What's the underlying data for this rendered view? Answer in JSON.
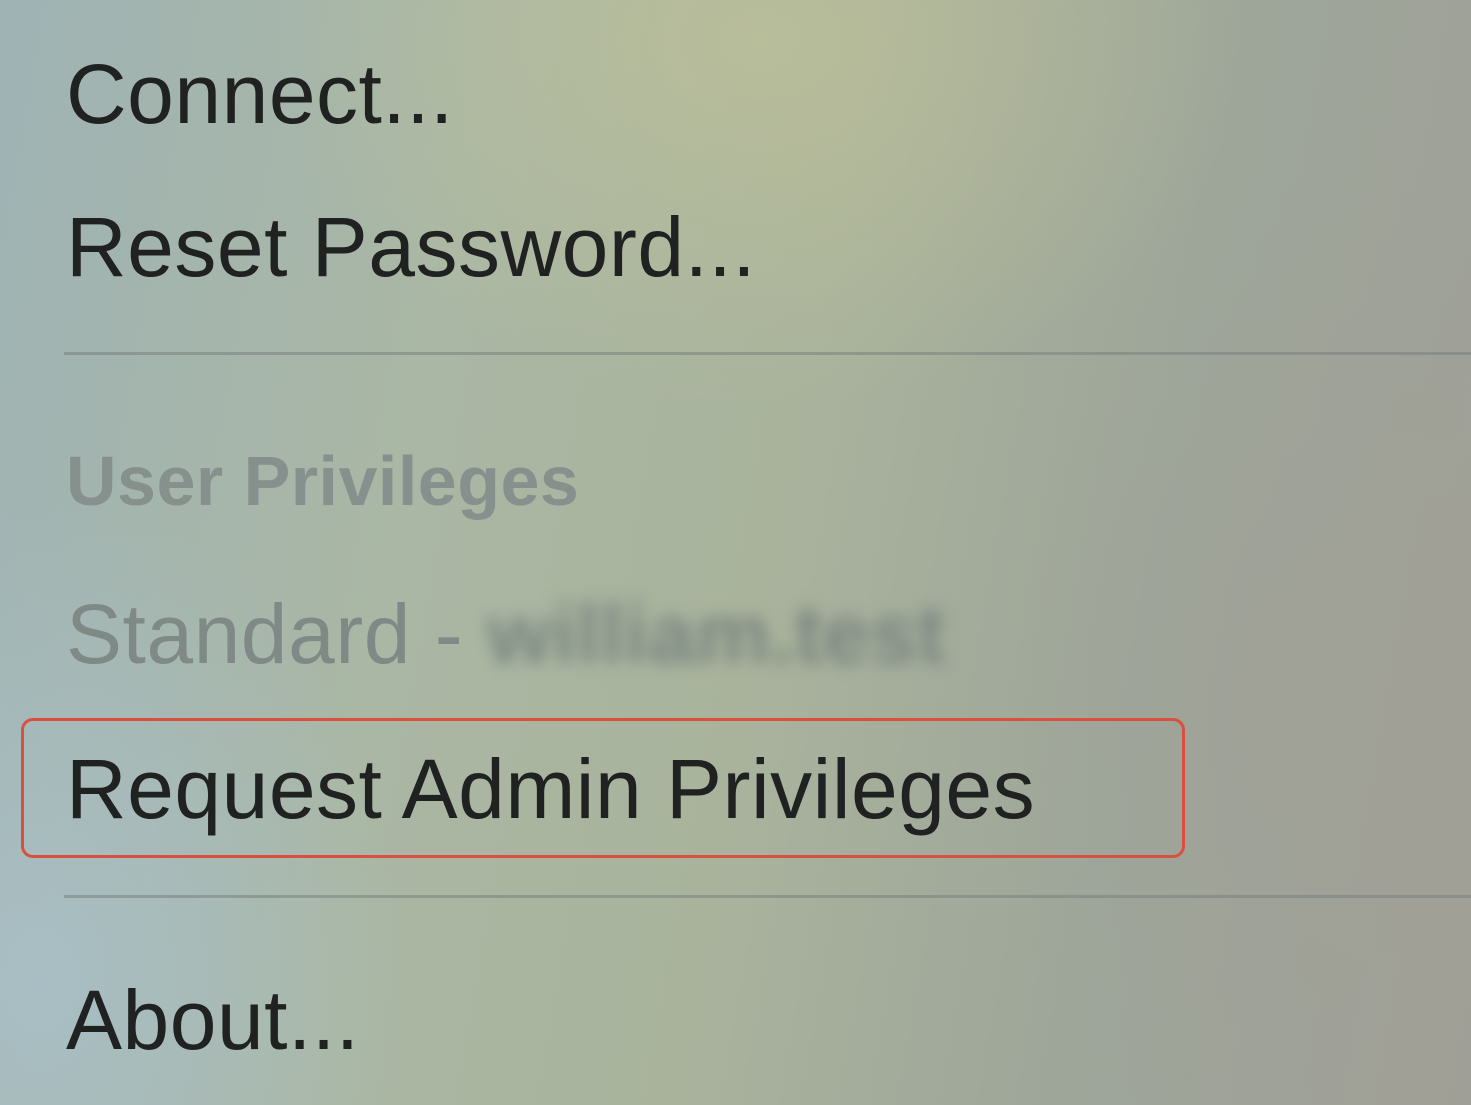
{
  "menu": {
    "connect_label": "Connect...",
    "reset_password_label": "Reset Password...",
    "section_header": "User Privileges",
    "current_privilege_prefix": "Standard - ",
    "current_privilege_user": "william.test",
    "request_admin_label": "Request Admin Privileges",
    "about_label": "About..."
  },
  "colors": {
    "highlight": "#d9503f",
    "text": "#1f2221",
    "disabled_text": "#7f8a87"
  }
}
